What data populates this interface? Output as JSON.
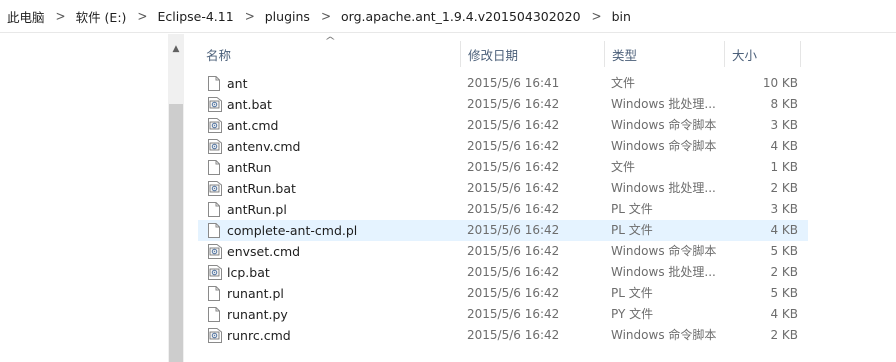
{
  "breadcrumb": [
    "此电脑",
    "软件 (E:)",
    "Eclipse-4.11",
    "plugins",
    "org.apache.ant_1.9.4.v201504302020",
    "bin"
  ],
  "breadcrumb_separator": ">",
  "columns": {
    "name": "名称",
    "date": "修改日期",
    "type": "类型",
    "size": "大小"
  },
  "sort_indicator": "^",
  "files": [
    {
      "name": "ant",
      "date": "2015/5/6 16:41",
      "type": "文件",
      "size": "10 KB",
      "icon": "blank-file-icon"
    },
    {
      "name": "ant.bat",
      "date": "2015/5/6 16:42",
      "type": "Windows 批处理...",
      "size": "8 KB",
      "icon": "batch-file-icon"
    },
    {
      "name": "ant.cmd",
      "date": "2015/5/6 16:42",
      "type": "Windows 命令脚本",
      "size": "3 KB",
      "icon": "batch-file-icon"
    },
    {
      "name": "antenv.cmd",
      "date": "2015/5/6 16:42",
      "type": "Windows 命令脚本",
      "size": "4 KB",
      "icon": "batch-file-icon"
    },
    {
      "name": "antRun",
      "date": "2015/5/6 16:42",
      "type": "文件",
      "size": "1 KB",
      "icon": "blank-file-icon"
    },
    {
      "name": "antRun.bat",
      "date": "2015/5/6 16:42",
      "type": "Windows 批处理...",
      "size": "2 KB",
      "icon": "batch-file-icon"
    },
    {
      "name": "antRun.pl",
      "date": "2015/5/6 16:42",
      "type": "PL 文件",
      "size": "3 KB",
      "icon": "blank-file-icon"
    },
    {
      "name": "complete-ant-cmd.pl",
      "date": "2015/5/6 16:42",
      "type": "PL 文件",
      "size": "4 KB",
      "icon": "blank-file-icon",
      "selected": true
    },
    {
      "name": "envset.cmd",
      "date": "2015/5/6 16:42",
      "type": "Windows 命令脚本",
      "size": "5 KB",
      "icon": "batch-file-icon"
    },
    {
      "name": "lcp.bat",
      "date": "2015/5/6 16:42",
      "type": "Windows 批处理...",
      "size": "2 KB",
      "icon": "batch-file-icon"
    },
    {
      "name": "runant.pl",
      "date": "2015/5/6 16:42",
      "type": "PL 文件",
      "size": "5 KB",
      "icon": "blank-file-icon"
    },
    {
      "name": "runant.py",
      "date": "2015/5/6 16:42",
      "type": "PY 文件",
      "size": "4 KB",
      "icon": "blank-file-icon"
    },
    {
      "name": "runrc.cmd",
      "date": "2015/5/6 16:42",
      "type": "Windows 命令脚本",
      "size": "2 KB",
      "icon": "batch-file-icon"
    }
  ],
  "colors": {
    "selection": "#e5f3ff",
    "header_text": "#4c607a",
    "secondary_text": "#6d6d6d"
  }
}
